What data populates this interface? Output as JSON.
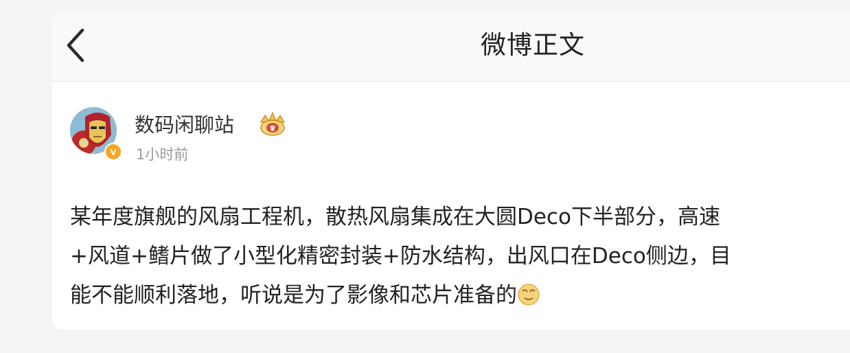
{
  "header": {
    "title": "微博正文",
    "back_icon": "chevron-left-icon"
  },
  "post": {
    "author": {
      "name": "数码闲聊站",
      "avatar_icon": "iron-man-avatar",
      "verified_badge": "V",
      "member_icon": "crown-icon"
    },
    "time": "1小时前",
    "lines": [
      "某年度旗舰的风扇工程机，散热风扇集成在大圆Deco下半部分，高速",
      "+风道+鳍片做了小型化精密封装+防水结构，出风口在Deco侧边，目",
      "能不能顺利落地，听说是为了影像和芯片准备的"
    ],
    "trailing_emoji": "doge-emoji"
  },
  "colors": {
    "background": "#f4f4f6",
    "card": "#ffffff",
    "header_bg": "#f9f9fb",
    "text": "#222222",
    "muted": "#999999",
    "badge": "#f5a623"
  }
}
